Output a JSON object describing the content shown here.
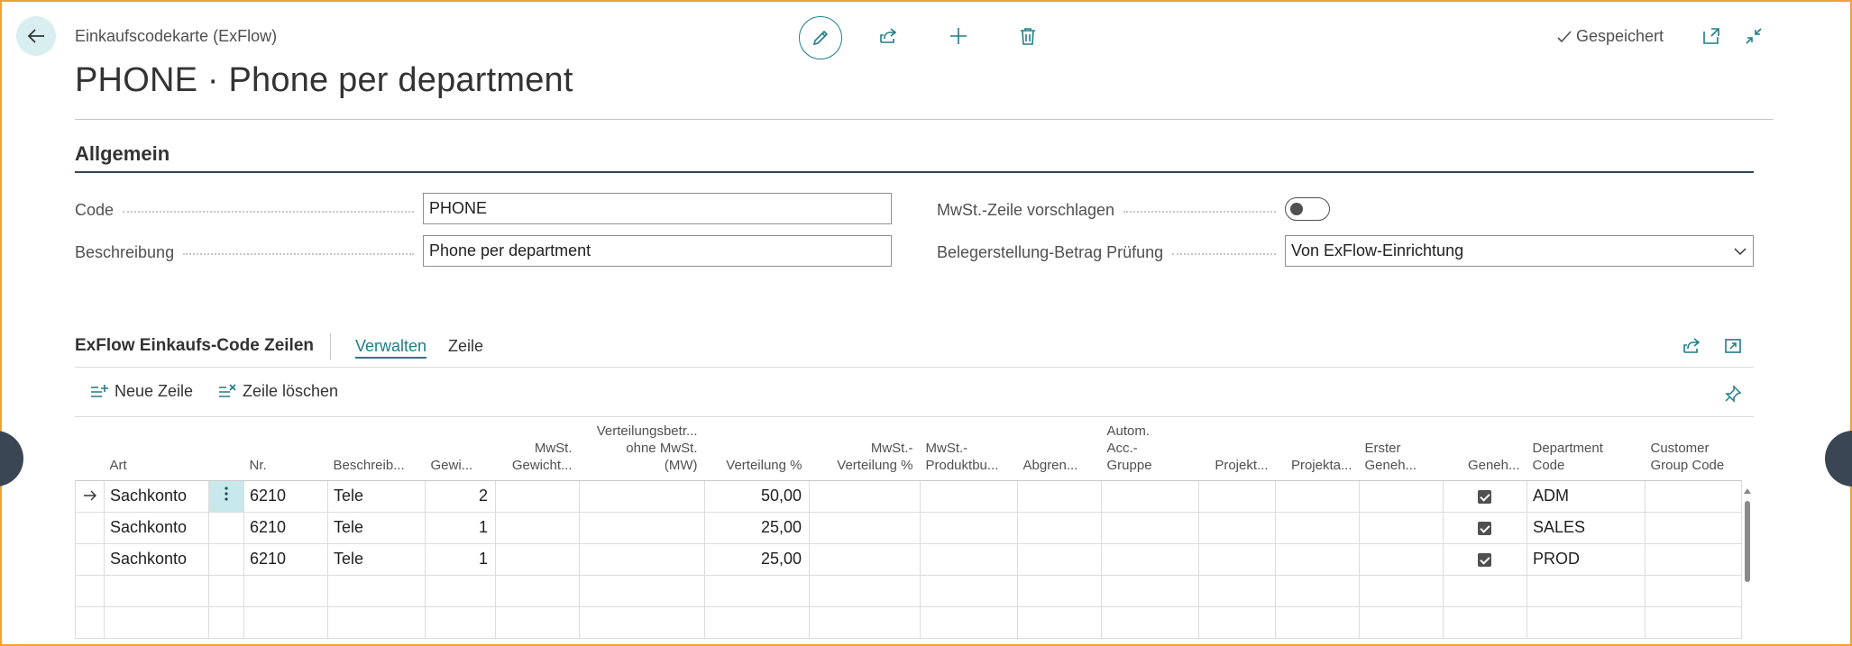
{
  "header": {
    "breadcrumb": "Einkaufscodekarte (ExFlow)",
    "title": "PHONE · Phone per department",
    "saved_label": "Gespeichert"
  },
  "general": {
    "section_title": "Allgemein",
    "code_label": "Code",
    "code_value": "PHONE",
    "description_label": "Beschreibung",
    "description_value": "Phone per department",
    "vat_line_label": "MwSt.-Zeile vorschlagen",
    "vat_line_on": false,
    "amount_check_label": "Belegerstellung-Betrag Prüfung",
    "amount_check_value": "Von ExFlow-Einrichtung"
  },
  "lines": {
    "title": "ExFlow Einkaufs-Code Zeilen",
    "tab_manage": "Verwalten",
    "tab_line": "Zeile",
    "new_line": "Neue Zeile",
    "delete_line": "Zeile löschen",
    "columns": {
      "art": "Art",
      "nr": "Nr.",
      "beschreib": "Beschreib...",
      "gewi": "Gewi...",
      "mwst_gew_1": "MwSt.",
      "mwst_gew_2": "Gewicht...",
      "vert_betr_1": "Verteilungsbetr...",
      "vert_betr_2": "ohne MwSt.",
      "vert_betr_3": "(MW)",
      "vert_pct": "Verteilung %",
      "mwst_vert_1": "MwSt.-",
      "mwst_vert_2": "Verteilung %",
      "mwst_prod_1": "MwSt.-",
      "mwst_prod_2": "Produktbu...",
      "abgren": "Abgren...",
      "autom_1": "Autom.",
      "autom_2": "Acc.-",
      "autom_3": "Gruppe",
      "projekt": "Projekt...",
      "projekta": "Projekta...",
      "erster_1": "Erster",
      "erster_2": "Geneh...",
      "geneh": "Geneh...",
      "dept_1": "Department",
      "dept_2": "Code",
      "cust_1": "Customer",
      "cust_2": "Group Code"
    },
    "rows": [
      {
        "art": "Sachkonto",
        "nr": "6210",
        "beschreib": "Tele",
        "gewi": "2",
        "vert_pct": "50,00",
        "geneh": true,
        "dept": "ADM"
      },
      {
        "art": "Sachkonto",
        "nr": "6210",
        "beschreib": "Tele",
        "gewi": "1",
        "vert_pct": "25,00",
        "geneh": true,
        "dept": "SALES"
      },
      {
        "art": "Sachkonto",
        "nr": "6210",
        "beschreib": "Tele",
        "gewi": "1",
        "vert_pct": "25,00",
        "geneh": true,
        "dept": "PROD"
      }
    ]
  },
  "colors": {
    "accent": "#1f7d86",
    "frame": "#f2a234",
    "selected_cell": "#c9e8ec"
  }
}
